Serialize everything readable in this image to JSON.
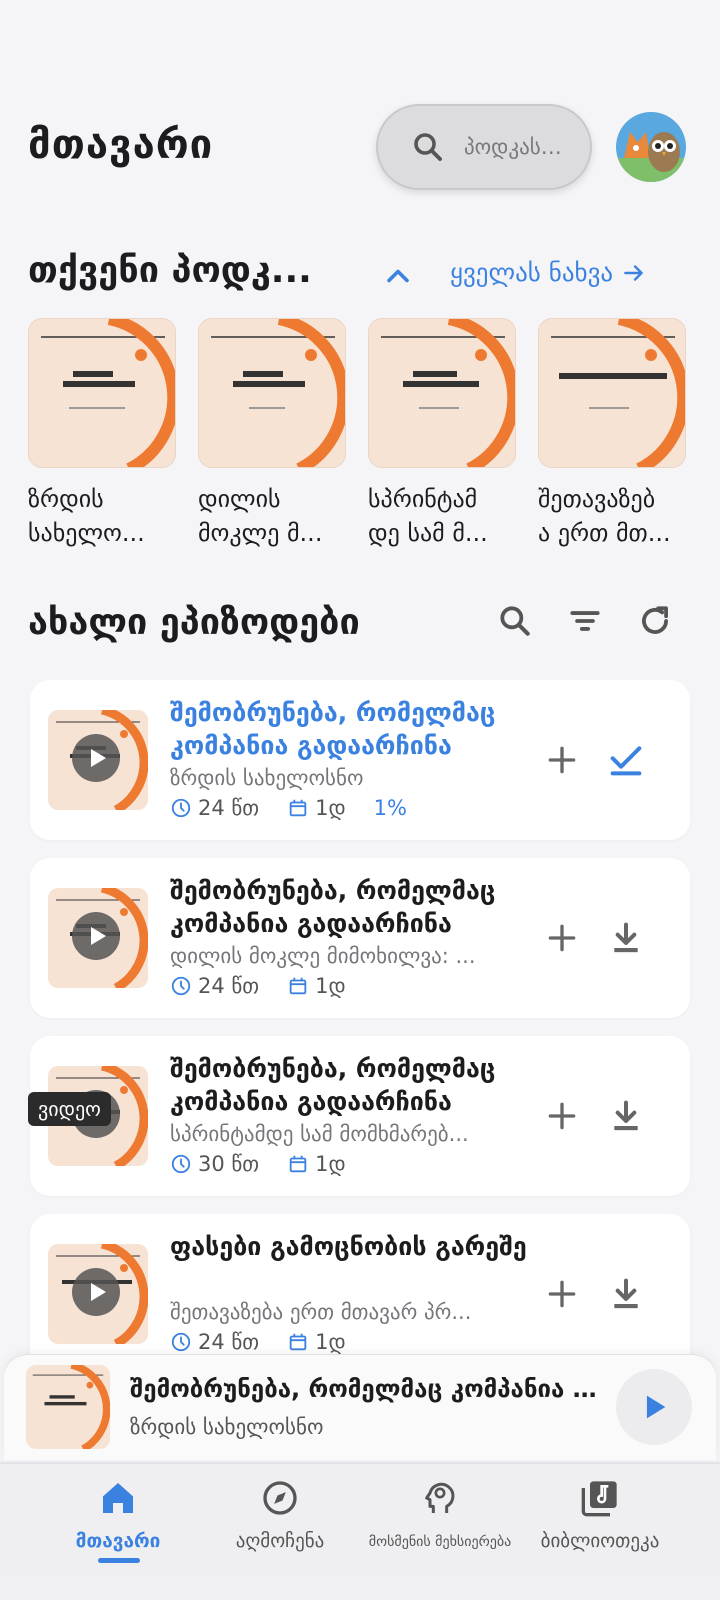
{
  "header": {
    "title": "მთავარი",
    "search_placeholder": "პოდკასტების ძიება"
  },
  "podcasts_section": {
    "title": "თქვენი პოდკ...",
    "see_all_label": "ყველას ნახვა",
    "items": [
      {
        "name": "ზრდის\nსახელო..."
      },
      {
        "name": "დილის\nმოკლე მ..."
      },
      {
        "name": "სპრინტამ\nდე სამ მ..."
      },
      {
        "name": "შეთავაზებ\nა ერთ მთ..."
      }
    ]
  },
  "episodes_section": {
    "title": "ახალი ეპიზოდები",
    "items": [
      {
        "title": "შემობრუნება, რომელმაც კომპანია გადაარჩინა",
        "podcast": "ზრდის სახელოსნო",
        "duration": "24 წთ",
        "age": "1დ",
        "progress": "1%",
        "active": true,
        "downloaded": true
      },
      {
        "title": "შემობრუნება, რომელმაც კომპანია გადაარჩინა",
        "podcast": "დილის მოკლე მიმოხილვა: ...",
        "duration": "24 წთ",
        "age": "1დ",
        "progress": "",
        "active": false,
        "downloaded": false
      },
      {
        "title": "შემობრუნება, რომელმაც კომპანია გადაარჩინა",
        "podcast": "სპრინტამდე სამ მომხმარებ...",
        "duration": "30 წთ",
        "age": "1დ",
        "progress": "",
        "active": false,
        "downloaded": false,
        "badge": "ვიდეო"
      },
      {
        "title": "ფასები გამოცნობის გარეშე",
        "podcast": "შეთავაზება ერთ მთავარ პრ...",
        "duration": "24 წთ",
        "age": "1დ",
        "progress": "",
        "active": false,
        "downloaded": false
      }
    ]
  },
  "mini_player": {
    "title": "შემობრუნება, რომელმაც კომპანია გადაარჩინა",
    "podcast": "ზრდის სახელოსნო"
  },
  "bottom_nav": {
    "items": [
      {
        "label": "მთავარი",
        "icon": "home-icon",
        "active": true
      },
      {
        "label": "აღმოჩენა",
        "icon": "compass-icon",
        "active": false
      },
      {
        "label": "მოსმენის მეხსიერება",
        "icon": "memory-icon",
        "active": false
      },
      {
        "label": "ბიბლიოთეკა",
        "icon": "library-icon",
        "active": false
      }
    ]
  },
  "colors": {
    "accent": "#3b82e0",
    "artwork_bg": "#f7e3d4",
    "artwork_arc": "#ee7a32",
    "background": "#f5f5f8"
  }
}
